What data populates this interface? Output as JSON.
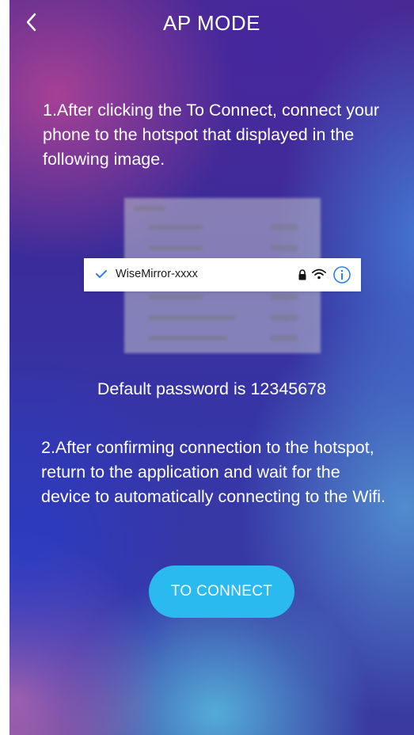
{
  "header": {
    "title": "AP MODE",
    "back_icon": "chevron-left-icon"
  },
  "instructions": {
    "step1": "1.After clicking the To Connect, connect your phone to the hotspot that displayed in the following image.",
    "step2": "2.After confirming connection to the hotspot, return to the application and wait for the device to automatically connecting to the Wifi."
  },
  "illustration": {
    "network_name": "WiseMirror-xxxx",
    "icons": [
      "checkmark-icon",
      "lock-icon",
      "wifi-icon",
      "info-icon"
    ]
  },
  "password_note": "Default password is 12345678",
  "connect_button": {
    "label": "TO CONNECT"
  },
  "colors": {
    "accent": "#2bbaf0",
    "info_blue": "#2f7df6",
    "text": "#ffffff"
  }
}
